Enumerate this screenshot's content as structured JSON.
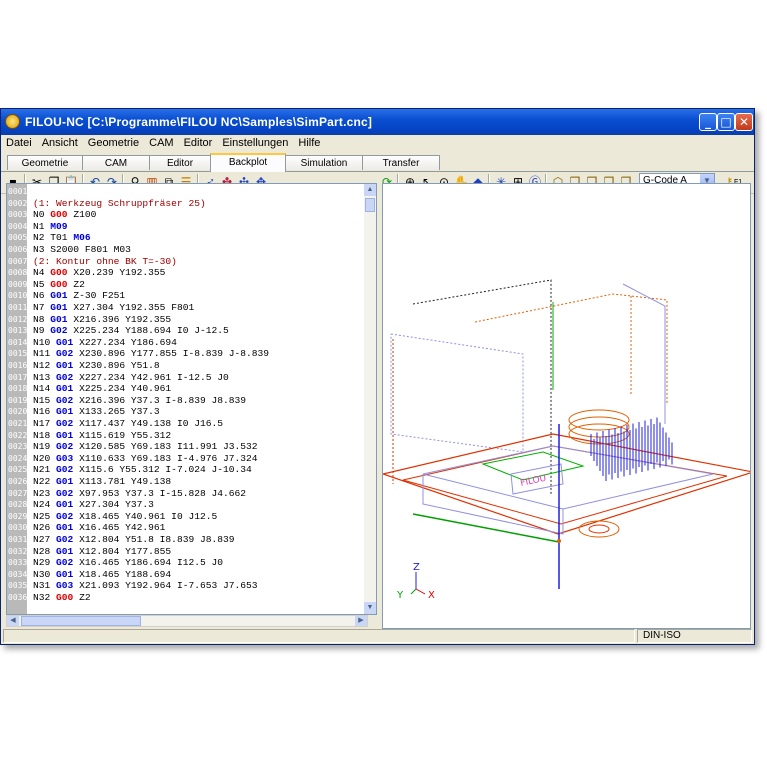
{
  "window": {
    "title": "FILOU-NC   [C:\\Programme\\FILOU NC\\Samples\\SimPart.cnc]",
    "buttons": {
      "minimize": "_",
      "maximize": "□",
      "close": "✕"
    }
  },
  "menu": [
    "Datei",
    "Ansicht",
    "Geometrie",
    "CAM",
    "Editor",
    "Einstellungen",
    "Hilfe"
  ],
  "tabs": [
    {
      "label": "Geometrie",
      "active": false
    },
    {
      "label": "CAM",
      "active": false
    },
    {
      "label": "Editor",
      "active": false
    },
    {
      "label": "Backplot",
      "active": true
    },
    {
      "label": "Simulation",
      "active": false
    },
    {
      "label": "Transfer",
      "active": false
    }
  ],
  "toolbar": {
    "gcode_select": "G-Code A",
    "help_label": "F1"
  },
  "editor": {
    "line_numbers": [
      "0001",
      "0002",
      "0003",
      "0004",
      "0005",
      "0006",
      "0007",
      "0008",
      "0009",
      "0010",
      "0011",
      "0012",
      "0013",
      "0014",
      "0015",
      "0016",
      "0017",
      "0018",
      "0019",
      "0020",
      "0021",
      "0022",
      "0023",
      "0024",
      "0025",
      "0026",
      "0027",
      "0028",
      "0029",
      "0030",
      "0031",
      "0032",
      "0033",
      "0034",
      "0035",
      "0036"
    ],
    "lines": [
      [],
      [
        [
          "cmt",
          "(1: Werkzeug Schruppfräser 25)"
        ]
      ],
      [
        [
          "t",
          "N0 "
        ],
        [
          "kr",
          "G00"
        ],
        [
          "t",
          " Z100"
        ]
      ],
      [
        [
          "t",
          "N1 "
        ],
        [
          "kb",
          "M09"
        ]
      ],
      [
        [
          "t",
          "N2 T01 "
        ],
        [
          "kb",
          "M06"
        ]
      ],
      [
        [
          "t",
          "N3 S2000 F801 M03"
        ]
      ],
      [
        [
          "cmt",
          "(2: Kontur ohne BK T=-30)"
        ]
      ],
      [
        [
          "t",
          "N4 "
        ],
        [
          "kr",
          "G00"
        ],
        [
          "t",
          " X20.239 Y192.355"
        ]
      ],
      [
        [
          "t",
          "N5 "
        ],
        [
          "kr",
          "G00"
        ],
        [
          "t",
          " Z2"
        ]
      ],
      [
        [
          "t",
          "N6 "
        ],
        [
          "kb",
          "G01"
        ],
        [
          "t",
          " Z-30 F251"
        ]
      ],
      [
        [
          "t",
          "N7 "
        ],
        [
          "kb",
          "G01"
        ],
        [
          "t",
          " X27.304 Y192.355 F801"
        ]
      ],
      [
        [
          "t",
          "N8 "
        ],
        [
          "kb",
          "G01"
        ],
        [
          "t",
          " X216.396 Y192.355"
        ]
      ],
      [
        [
          "t",
          "N9 "
        ],
        [
          "kb",
          "G02"
        ],
        [
          "t",
          " X225.234 Y188.694 I0 J-12.5"
        ]
      ],
      [
        [
          "t",
          "N10 "
        ],
        [
          "kb",
          "G01"
        ],
        [
          "t",
          " X227.234 Y186.694"
        ]
      ],
      [
        [
          "t",
          "N11 "
        ],
        [
          "kb",
          "G02"
        ],
        [
          "t",
          " X230.896 Y177.855 I-8.839 J-8.839"
        ]
      ],
      [
        [
          "t",
          "N12 "
        ],
        [
          "kb",
          "G01"
        ],
        [
          "t",
          " X230.896 Y51.8"
        ]
      ],
      [
        [
          "t",
          "N13 "
        ],
        [
          "kb",
          "G02"
        ],
        [
          "t",
          " X227.234 Y42.961 I-12.5 J0"
        ]
      ],
      [
        [
          "t",
          "N14 "
        ],
        [
          "kb",
          "G01"
        ],
        [
          "t",
          " X225.234 Y40.961"
        ]
      ],
      [
        [
          "t",
          "N15 "
        ],
        [
          "kb",
          "G02"
        ],
        [
          "t",
          " X216.396 Y37.3 I-8.839 J8.839"
        ]
      ],
      [
        [
          "t",
          "N16 "
        ],
        [
          "kb",
          "G01"
        ],
        [
          "t",
          " X133.265 Y37.3"
        ]
      ],
      [
        [
          "t",
          "N17 "
        ],
        [
          "kb",
          "G02"
        ],
        [
          "t",
          " X117.437 Y49.138 I0 J16.5"
        ]
      ],
      [
        [
          "t",
          "N18 "
        ],
        [
          "kb",
          "G01"
        ],
        [
          "t",
          " X115.619 Y55.312"
        ]
      ],
      [
        [
          "t",
          "N19 "
        ],
        [
          "kb",
          "G02"
        ],
        [
          "t",
          " X120.585 Y69.183 I11.991 J3.532"
        ]
      ],
      [
        [
          "t",
          "N20 "
        ],
        [
          "kb",
          "G03"
        ],
        [
          "t",
          " X110.633 Y69.183 I-4.976 J7.324"
        ]
      ],
      [
        [
          "t",
          "N21 "
        ],
        [
          "kb",
          "G02"
        ],
        [
          "t",
          " X115.6 Y55.312 I-7.024 J-10.34"
        ]
      ],
      [
        [
          "t",
          "N22 "
        ],
        [
          "kb",
          "G01"
        ],
        [
          "t",
          " X113.781 Y49.138"
        ]
      ],
      [
        [
          "t",
          "N23 "
        ],
        [
          "kb",
          "G02"
        ],
        [
          "t",
          " X97.953 Y37.3 I-15.828 J4.662"
        ]
      ],
      [
        [
          "t",
          "N24 "
        ],
        [
          "kb",
          "G01"
        ],
        [
          "t",
          " X27.304 Y37.3"
        ]
      ],
      [
        [
          "t",
          "N25 "
        ],
        [
          "kb",
          "G02"
        ],
        [
          "t",
          " X18.465 Y40.961 I0 J12.5"
        ]
      ],
      [
        [
          "t",
          "N26 "
        ],
        [
          "kb",
          "G01"
        ],
        [
          "t",
          " X16.465 Y42.961"
        ]
      ],
      [
        [
          "t",
          "N27 "
        ],
        [
          "kb",
          "G02"
        ],
        [
          "t",
          " X12.804 Y51.8 I8.839 J8.839"
        ]
      ],
      [
        [
          "t",
          "N28 "
        ],
        [
          "kb",
          "G01"
        ],
        [
          "t",
          " X12.804 Y177.855"
        ]
      ],
      [
        [
          "t",
          "N29 "
        ],
        [
          "kb",
          "G02"
        ],
        [
          "t",
          " X16.465 Y186.694 I12.5 J0"
        ]
      ],
      [
        [
          "t",
          "N30 "
        ],
        [
          "kb",
          "G01"
        ],
        [
          "t",
          " X18.465 Y188.694"
        ]
      ],
      [
        [
          "t",
          "N31 "
        ],
        [
          "kb",
          "G03"
        ],
        [
          "t",
          " X21.093 Y192.964 I-7.653 J7.653"
        ]
      ],
      [
        [
          "t",
          "N32 "
        ],
        [
          "kr",
          "G00"
        ],
        [
          "t",
          " Z2"
        ]
      ]
    ]
  },
  "view3d": {
    "axis_labels": {
      "z": "Z",
      "y": "Y",
      "x": "X"
    },
    "colors": {
      "contour": "#e03000",
      "rapid": "#e06000",
      "drill": "#2020e0",
      "frame": "#9090e0",
      "green": "#00b000"
    }
  },
  "status": {
    "mode": "DIN-ISO"
  }
}
